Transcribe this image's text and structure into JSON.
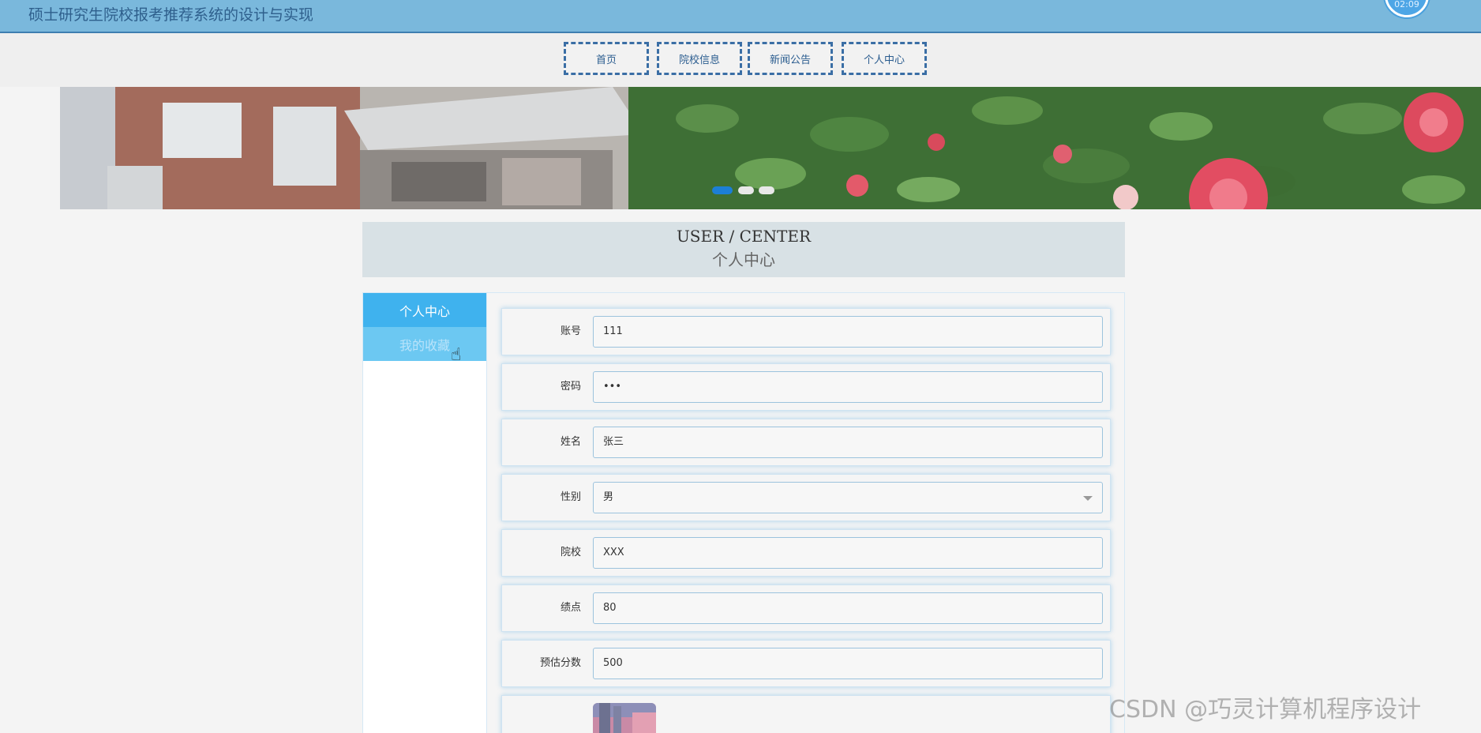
{
  "header": {
    "site_title": "硕士研究生院校报考推荐系统的设计与实现",
    "clock_text": "02:09"
  },
  "nav": {
    "items": [
      {
        "label": "首页"
      },
      {
        "label": "院校信息"
      },
      {
        "label": "新闻公告"
      },
      {
        "label": "个人中心"
      }
    ]
  },
  "banner": {
    "slides": 3,
    "active_slide": 1
  },
  "center": {
    "title_en": "USER / CENTER",
    "title_cn": "个人中心"
  },
  "sidebar": {
    "items": [
      {
        "label": "个人中心",
        "state": "active"
      },
      {
        "label": "我的收藏",
        "state": "hover"
      }
    ]
  },
  "form": {
    "account_label": "账号",
    "account_value": "111",
    "password_label": "密码",
    "password_value": "•••",
    "name_label": "姓名",
    "name_value": "张三",
    "gender_label": "性别",
    "gender_value": "男",
    "school_label": "院校",
    "school_value": "XXX",
    "gpa_label": "绩点",
    "gpa_value": "80",
    "score_label": "预估分数",
    "score_value": "500"
  },
  "watermark": "CSDN @巧灵计算机程序设计",
  "colors": {
    "header_bg": "#7ab8dc",
    "nav_border": "#3a6ea5",
    "sidebar_active": "#3fb2ee",
    "sidebar_hover": "#6cc8f2",
    "center_head_bg": "#d8e1e5"
  }
}
